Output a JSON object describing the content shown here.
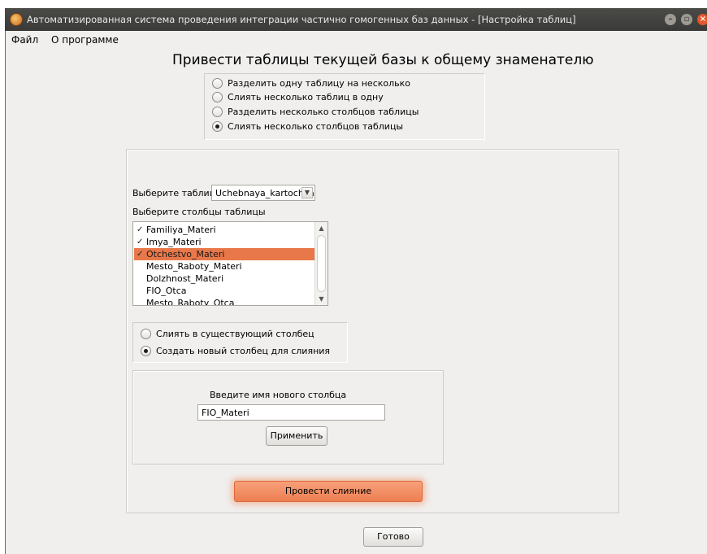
{
  "window": {
    "title": "Автоматизированная система проведения интеграции частично гомогенных баз данных - [Настройка таблиц]",
    "controls": {
      "minimize": "–",
      "maximize": "▫",
      "close": "×"
    }
  },
  "menu": {
    "items": [
      "Файл",
      "О программе"
    ]
  },
  "heading": "Привести таблицы текущей базы к общему знаменателю",
  "modes": {
    "options": [
      "Разделить одну таблицу на несколько",
      "Слиять несколько таблиц в одну",
      "Разделить несколько столбцов таблицы",
      "Слиять несколько столбцов таблицы"
    ],
    "selected_index": 3
  },
  "table_select": {
    "label": "Выберите таблицу",
    "value": "Uchebnaya_kartochka",
    "arrow": "▼"
  },
  "columns": {
    "label": "Выберите столбцы таблицы",
    "items": [
      {
        "name": "Familiya_Materi",
        "checked": true,
        "selected": false
      },
      {
        "name": "Imya_Materi",
        "checked": true,
        "selected": false
      },
      {
        "name": "Otchestvo_Materi",
        "checked": true,
        "selected": true
      },
      {
        "name": "Mesto_Raboty_Materi",
        "checked": false,
        "selected": false
      },
      {
        "name": "Dolzhnost_Materi",
        "checked": false,
        "selected": false
      },
      {
        "name": "FIO_Otca",
        "checked": false,
        "selected": false
      },
      {
        "name": "Mesto_Raboty_Otca",
        "checked": false,
        "selected": false
      }
    ],
    "check_mark": "✓",
    "scroll_up": "▲",
    "scroll_down": "▼"
  },
  "merge_target": {
    "options": [
      "Слиять в существующий столбец",
      "Создать новый столбец для слияния"
    ],
    "selected_index": 1
  },
  "new_column": {
    "label": "Введите имя нового столбца",
    "value": "FIO_Materi",
    "apply_label": "Применить"
  },
  "merge_button": "Провести слияние",
  "done_button": "Готово",
  "colors": {
    "accent": "#ee7f52",
    "selection": "#e8784a",
    "titlebar": "#3f3f3c",
    "close": "#e3582c"
  }
}
